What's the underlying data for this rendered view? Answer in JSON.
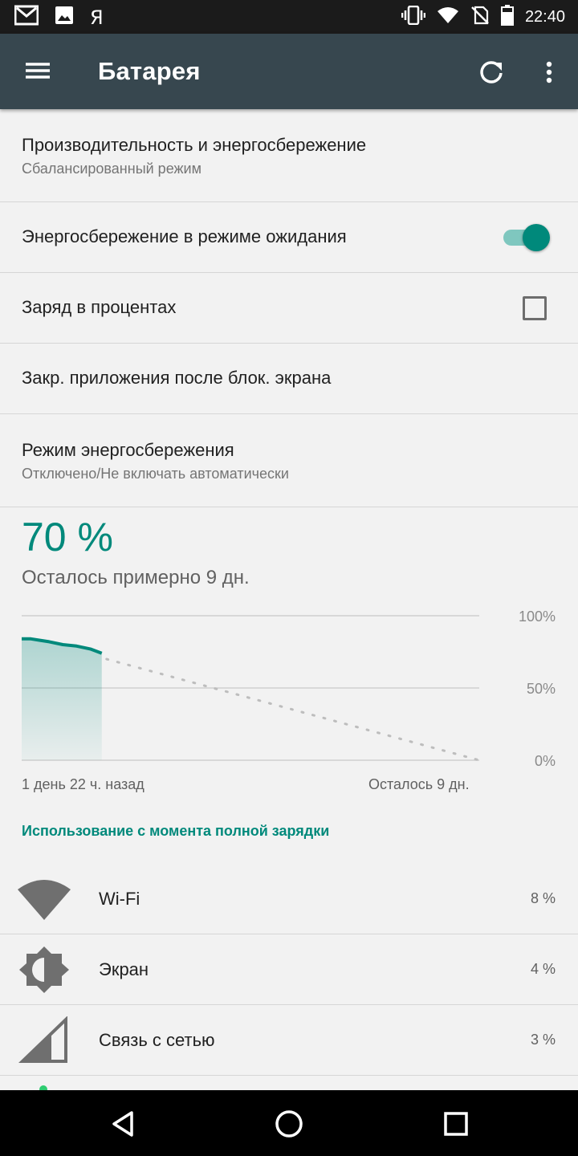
{
  "status_bar": {
    "time": "22:40",
    "app_letter": "Я",
    "icons": [
      "gmail-icon",
      "image-icon",
      "vibrate-icon",
      "wifi-icon",
      "no-sim-icon",
      "battery-icon"
    ]
  },
  "toolbar": {
    "title": "Батарея",
    "icons": [
      "menu-icon",
      "refresh-icon",
      "more-vert-icon"
    ]
  },
  "preferences": [
    {
      "title": "Производительность и энергосбережение",
      "summary": "Сбалансированный режим"
    },
    {
      "title": "Энергосбережение в режиме ожидания",
      "control": "switch",
      "checked": true
    },
    {
      "title": "Заряд в процентах",
      "control": "checkbox",
      "checked": false
    },
    {
      "title": "Закр. приложения после блок. экрана"
    },
    {
      "title": "Режим энергосбережения",
      "summary": "Отключено/Не включать автоматически"
    }
  ],
  "battery": {
    "percent_text": "70 %",
    "remaining_text": "Осталось примерно 9 дн."
  },
  "chart_data": {
    "type": "area",
    "y_ticks": [
      "100%",
      "50%",
      "0%"
    ],
    "ylim": [
      0,
      100
    ],
    "x_labels": [
      "1 день 22 ч. назад",
      "Осталось 9 дн."
    ],
    "history": [
      {
        "t": 0.0,
        "y": 84
      },
      {
        "t": 0.02,
        "y": 84
      },
      {
        "t": 0.04,
        "y": 83
      },
      {
        "t": 0.06,
        "y": 82
      },
      {
        "t": 0.09,
        "y": 80
      },
      {
        "t": 0.12,
        "y": 79
      },
      {
        "t": 0.15,
        "y": 77
      },
      {
        "t": 0.175,
        "y": 74
      }
    ],
    "projection": [
      {
        "t": 0.175,
        "y": 70
      },
      {
        "t": 1.0,
        "y": 0
      }
    ],
    "accent_color": "#00897b",
    "grid": true
  },
  "usage_section": {
    "title": "Использование с момента полной зарядки",
    "items": [
      {
        "name": "Wi-Fi",
        "value": "8 %",
        "icon": "wifi-icon"
      },
      {
        "name": "Экран",
        "value": "4 %",
        "icon": "brightness-icon"
      },
      {
        "name": "Связь с сетью",
        "value": "3 %",
        "icon": "signal-icon"
      }
    ]
  },
  "nav": {
    "icons": [
      "back-icon",
      "home-icon",
      "recents-icon"
    ]
  },
  "colors": {
    "accent": "#00897b",
    "toolbar": "#37474f",
    "status_bar": "#1b1b1b"
  }
}
